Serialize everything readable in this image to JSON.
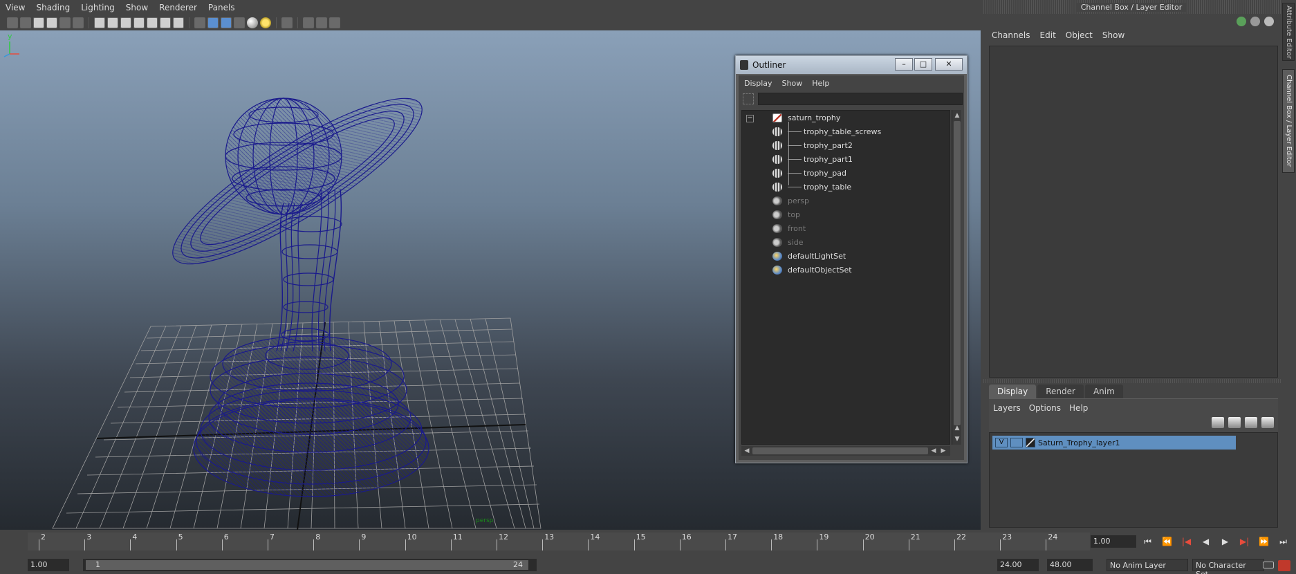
{
  "viewport": {
    "menu": [
      "View",
      "Shading",
      "Lighting",
      "Show",
      "Renderer",
      "Panels"
    ],
    "camera_label": "persp"
  },
  "outliner": {
    "title": "Outliner",
    "menu": [
      "Display",
      "Show",
      "Help"
    ],
    "search_placeholder": "",
    "tree": [
      {
        "label": "saturn_trophy",
        "icon": "group-icon",
        "level": 0,
        "dim": false
      },
      {
        "label": "trophy_table_screws",
        "icon": "mesh-icon",
        "level": 1,
        "dim": false
      },
      {
        "label": "trophy_part2",
        "icon": "mesh-icon",
        "level": 1,
        "dim": false
      },
      {
        "label": "trophy_part1",
        "icon": "mesh-icon",
        "level": 1,
        "dim": false
      },
      {
        "label": "trophy_pad",
        "icon": "mesh-icon",
        "level": 1,
        "dim": false
      },
      {
        "label": "trophy_table",
        "icon": "mesh-icon",
        "level": 1,
        "dim": false
      },
      {
        "label": "persp",
        "icon": "camera-icon",
        "level": 0,
        "dim": true
      },
      {
        "label": "top",
        "icon": "camera-icon",
        "level": 0,
        "dim": true
      },
      {
        "label": "front",
        "icon": "camera-icon",
        "level": 0,
        "dim": true
      },
      {
        "label": "side",
        "icon": "camera-icon",
        "level": 0,
        "dim": true
      },
      {
        "label": "defaultLightSet",
        "icon": "set-icon",
        "level": 0,
        "dim": false
      },
      {
        "label": "defaultObjectSet",
        "icon": "set-icon",
        "level": 0,
        "dim": false
      }
    ]
  },
  "channel_box": {
    "title": "Channel Box / Layer Editor",
    "menu": [
      "Channels",
      "Edit",
      "Object",
      "Show"
    ]
  },
  "layer_editor": {
    "tabs": [
      "Display",
      "Render",
      "Anim"
    ],
    "active_tab": "Display",
    "menu": [
      "Layers",
      "Options",
      "Help"
    ],
    "layers": [
      {
        "visible": "V",
        "name": "Saturn_Trophy_layer1"
      }
    ]
  },
  "side_tabs": [
    "Attribute Editor",
    "Channel Box / Layer Editor"
  ],
  "timeline": {
    "ticks": [
      "2",
      "3",
      "4",
      "5",
      "6",
      "7",
      "8",
      "9",
      "10",
      "11",
      "12",
      "13",
      "14",
      "15",
      "16",
      "17",
      "18",
      "19",
      "20",
      "21",
      "22",
      "23",
      "24"
    ],
    "current_time": "1.00"
  },
  "range": {
    "start_time": "1.00",
    "range_start": "1",
    "range_end": "24",
    "end_time": "24.00",
    "playback_end": "48.00",
    "anim_layer": "No Anim Layer",
    "character_set": "No Character Set"
  },
  "colors": {
    "wireframe": "#1a1a8c",
    "layer_highlight": "#5f8fc0",
    "grid": "#9a9a9a"
  }
}
